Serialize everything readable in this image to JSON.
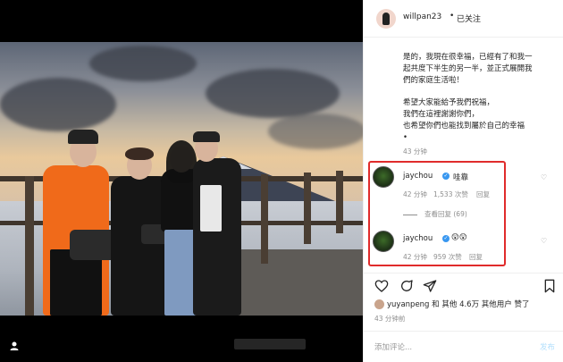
{
  "post": {
    "username": "willpan23",
    "separator": "•",
    "follow_status": "已关注",
    "caption_lines": [
      "是的，我現在很幸福，已經有了和我一",
      "起共度下半生的另一半，並正式展開我",
      "們的家庭生活啦！",
      "",
      "希望大家能給予我們祝福，",
      "我們在這裡謝謝你們，",
      "也希望你們也能找到屬於自己的幸福",
      "•"
    ],
    "caption_time": "43 分钟"
  },
  "comments": [
    {
      "username": "jaychou",
      "verified": true,
      "text": "哇靠",
      "time": "42 分钟",
      "likes": "1,533 次赞",
      "reply_label": "回复"
    },
    {
      "username": "jaychou",
      "verified": true,
      "text": "😲😲",
      "time": "42 分钟",
      "likes": "959 次赞",
      "reply_label": "回复"
    }
  ],
  "view_replies": "查看回复 (69)",
  "likes_summary": {
    "user": "yuyanpeng",
    "and_label": "和",
    "others": "其他 4.6万 其他用户",
    "suffix": "赞了"
  },
  "post_time": "43 分钟前",
  "comment_input": {
    "placeholder": "添加评论...",
    "submit_label": "发布"
  },
  "colors": {
    "highlight_border": "#e02b2b",
    "verified_badge": "#3897f0",
    "meta_text": "#8e8e8e",
    "post_button_disabled": "#b2dffc"
  },
  "icons": [
    "heart-icon",
    "comment-icon",
    "share-icon",
    "bookmark-icon",
    "verified-icon",
    "user-icon"
  ]
}
